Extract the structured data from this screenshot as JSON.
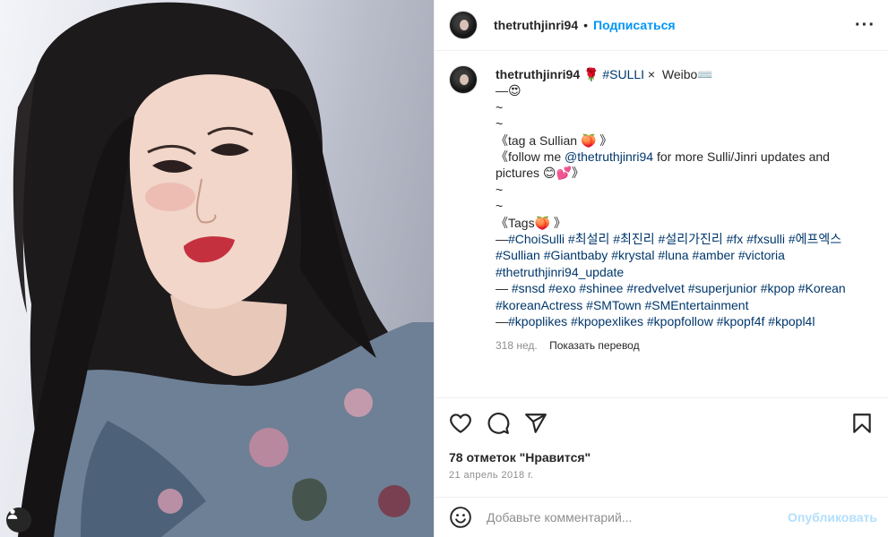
{
  "post": {
    "username": "thetruthjinri94",
    "follow_label": "Подписаться",
    "dot": "•",
    "more_label": "···"
  },
  "caption": {
    "username": "thetruthjinri94",
    "line1_tail": " 🌹 ",
    "hashtag_sulli": "#SULLI",
    "line1_weibo": " ×  Weibo⌨️",
    "line2": "—😍",
    "line3": "~",
    "line4": "~",
    "line5": "《tag a Sullian 🍑 》",
    "line6_start": "《follow me ",
    "mention": "@thetruthjinri94",
    "line6_end": " for more Sulli/Jinri updates and pictures 😊💕》",
    "line7": "~",
    "line8": "~",
    "line9": "《Tags🍑 》",
    "tags_block1_prefix": "—",
    "tags_block1": "#ChoiSulli #최설리 #최진리 #설리가진리 #fx #fxsulli #에프엑스 #Sullian #Giantbaby #krystal #luna #amber #victoria #thetruthjinri94_update",
    "tags_block2_prefix": "— ",
    "tags_block2": "#snsd #exo #shinee #redvelvet #superjunior #kpop #Korean #koreanActress #SMTown #SMEntertainment",
    "tags_block3_prefix": "—",
    "tags_block3": "#kpoplikes #kpopexlikes #kpopfollow #kpopf4f #kpopl4l",
    "age": "318 нед.",
    "translate_label": "Показать перевод"
  },
  "engagement": {
    "likes_text": "78 отметок \"Нравится\"",
    "date": "21 апрель 2018 г."
  },
  "comment": {
    "placeholder": "Добавьте комментарий...",
    "publish_label": "Опубликовать"
  },
  "icons": [
    "heart-icon",
    "comment-icon",
    "share-icon",
    "bookmark-icon",
    "emoji-icon",
    "user-tag-icon",
    "more-icon"
  ],
  "colors": {
    "link": "#00376b",
    "follow": "#0095f6",
    "publish_disabled": "#b2dffc",
    "muted": "#8e8e8e",
    "text": "#262626"
  }
}
